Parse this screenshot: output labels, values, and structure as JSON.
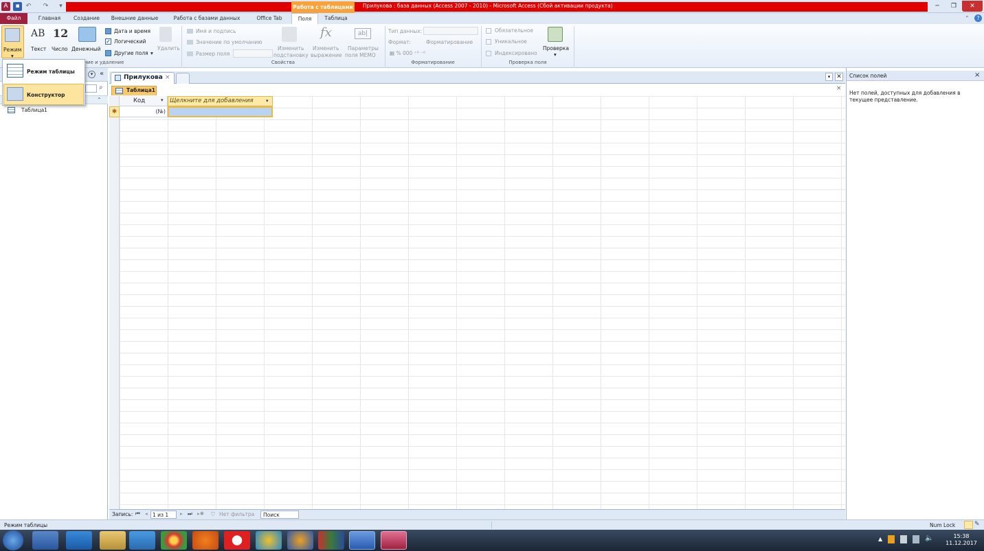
{
  "titlebar": {
    "context_tab": "Работа с таблицами",
    "window_title": "Прилукова : база данных (Access 2007 - 2010)  -  Microsoft Access (Сбой активации продукта)"
  },
  "tabs": [
    "Файл",
    "Главная",
    "Создание",
    "Внешние данные",
    "Работа с базами данных",
    "Office Tab",
    "Поля",
    "Таблица"
  ],
  "ribbon": {
    "mode_label": "Режим",
    "text_label": "Текст",
    "number_label": "Число",
    "currency_label": "Денежный",
    "ab_glyph": "AB",
    "twelve_glyph": "12",
    "date_time": "Дата и время",
    "logical": "Логический",
    "other_fields": "Другие поля",
    "delete": "Удалить",
    "group_add_delete": "вление и удаление",
    "name_caption": "Имя и подпись",
    "default_value": "Значение по умолчанию",
    "field_size": "Размер поля",
    "change_lookup_1": "Изменить",
    "change_lookup_2": "подстановку",
    "change_expr_1": "Изменить",
    "change_expr_2": "выражение",
    "memo_1": "Параметры",
    "memo_2": "поля MEMO",
    "group_properties": "Свойства",
    "data_type": "Тип данных:",
    "format": "Формат:",
    "format_value": "Форматирование",
    "group_formatting": "Форматирование",
    "required": "Обязательное",
    "unique": "Уникальное",
    "indexed": "Индексировано",
    "validation": "Проверка",
    "group_validation": "Проверка поля"
  },
  "mode_menu": {
    "datasheet": "Режим таблицы",
    "design": "Конструктор"
  },
  "nav": {
    "items": [
      "Таблица1"
    ]
  },
  "doc": {
    "outer_tab": "Прилукова",
    "inner_tab": "Таблица1",
    "col_id": "Код",
    "col_add": "Щелкните для добавления",
    "new_row_value": "(№)"
  },
  "recordbar": {
    "label": "Запись:",
    "position": "1 из 1",
    "filter": "Нет фильтра",
    "search": "Поиск"
  },
  "fieldlist": {
    "title": "Список полей",
    "message": "Нет полей, доступных для добавления в текущее представление."
  },
  "status": {
    "mode": "Режим таблицы",
    "numlock": "Num Lock"
  },
  "taskbar": {
    "time": "15:38",
    "date": "11.12.2017"
  }
}
